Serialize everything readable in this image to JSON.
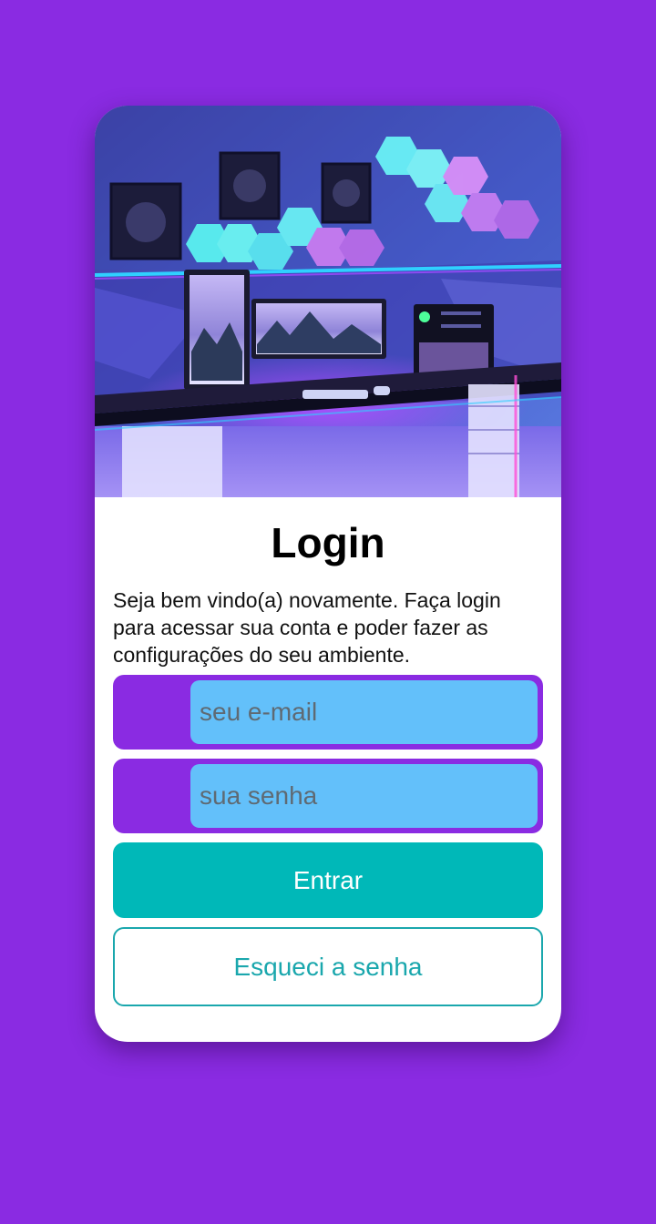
{
  "colors": {
    "background": "#8a2be2",
    "card": "#ffffff",
    "input_container": "#8a2be2",
    "input_fill": "#63c0fa",
    "primary_button": "#00b8b8",
    "secondary_border": "#1aa7ad"
  },
  "hero": {
    "icon": "gaming-room-illustration"
  },
  "login": {
    "title": "Login",
    "subtitle": "Seja bem vindo(a) novamente. Faça login para acessar sua conta e poder fazer as configurações do seu ambiente.",
    "email_placeholder": "seu e-mail",
    "email_value": "",
    "password_placeholder": "sua senha",
    "password_value": "",
    "submit_label": "Entrar",
    "forgot_label": "Esqueci a senha"
  }
}
